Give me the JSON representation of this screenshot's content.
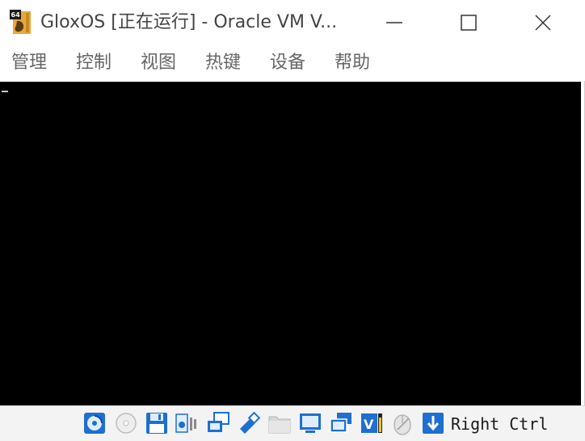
{
  "window": {
    "title": "GloxOS [正在运行] - Oracle VM V...",
    "app_icon": "virtualbox-64-icon"
  },
  "menu": {
    "items": [
      {
        "label": "管理"
      },
      {
        "label": "控制"
      },
      {
        "label": "视图"
      },
      {
        "label": "热键"
      },
      {
        "label": "设备"
      },
      {
        "label": "帮助"
      }
    ]
  },
  "screen": {
    "background": "#000000",
    "cursor_char": "_"
  },
  "statusbar": {
    "icons": [
      "hard-disk-icon",
      "optical-drive-icon",
      "floppy-drive-icon",
      "audio-icon",
      "network-icon",
      "usb-icon",
      "shared-folders-icon",
      "display-icon",
      "recording-icon",
      "vt-x-icon",
      "mouse-integration-icon",
      "host-key-arrow-icon"
    ],
    "host_key": "Right Ctrl"
  },
  "colors": {
    "title_text": "#444444",
    "menu_text": "#666666",
    "accent_blue": "#1e6fd0"
  }
}
